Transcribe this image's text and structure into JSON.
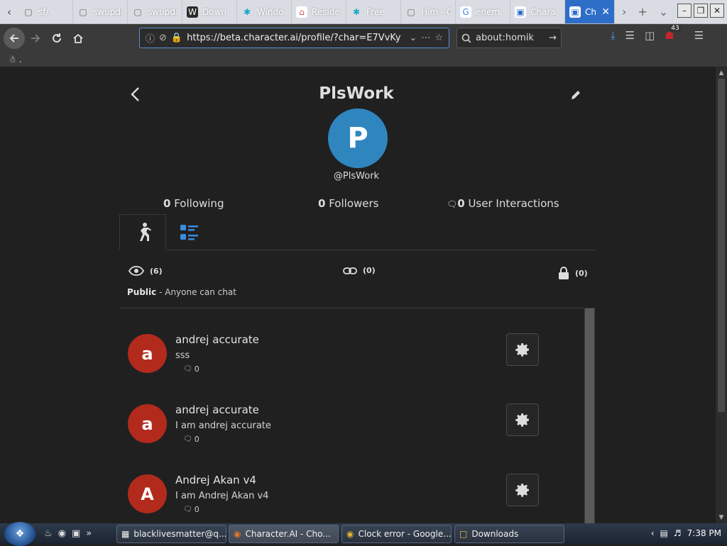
{
  "browser": {
    "tabs": [
      {
        "label": "sf/",
        "icon": "page-icon",
        "fav_bg": "#d9dde3",
        "fav_fg": "#666"
      },
      {
        "label": "swupdate",
        "icon": "page-icon",
        "fav_bg": "#d9dde3",
        "fav_fg": "#666"
      },
      {
        "label": "swupdate",
        "icon": "page-icon",
        "fav_bg": "#d9dde3",
        "fav_fg": "#666"
      },
      {
        "label": "Down",
        "icon": "w-logo-icon",
        "fav_bg": "#2a2a2a",
        "fav_fg": "#fff"
      },
      {
        "label": "Windo",
        "icon": "asterisk-icon",
        "fav_bg": "transparent",
        "fav_fg": "#1aa6c9"
      },
      {
        "label": "Reside",
        "icon": "house-icon",
        "fav_bg": "#fff",
        "fav_fg": "#d9534f"
      },
      {
        "label": "Free",
        "icon": "asterisk-icon",
        "fav_bg": "transparent",
        "fav_fg": "#1aa6c9"
      },
      {
        "label": "Him - Cha",
        "icon": "page-icon",
        "fav_bg": "#d9dde3",
        "fav_fg": "#666"
      },
      {
        "label": "enem",
        "icon": "google-icon",
        "fav_bg": "#fff",
        "fav_fg": "#4285f4"
      },
      {
        "label": "Chara",
        "icon": "character-ai-icon",
        "fav_bg": "#fff",
        "fav_fg": "#2e6ec8"
      },
      {
        "label": "Ch",
        "icon": "character-ai-icon",
        "fav_bg": "#fff",
        "fav_fg": "#2e6ec8"
      }
    ],
    "url": "https://beta.character.ai/profile/?char=E7VvKy",
    "search_value": "about:homik",
    "addon_badge": "43",
    "bookmark_label": "."
  },
  "page": {
    "title": "PlsWork",
    "avatar_letter": "P",
    "handle": "@PlsWork",
    "stats": [
      {
        "count": "0",
        "label": "Following"
      },
      {
        "count": "0",
        "label": "Followers"
      },
      {
        "count": "0",
        "label": "User Interactions"
      }
    ],
    "filters": [
      {
        "icon": "eye-icon",
        "count": "(6)"
      },
      {
        "icon": "link-icon",
        "count": "(0)"
      },
      {
        "icon": "lock-icon",
        "count": "(0)"
      }
    ],
    "visibility": {
      "label": "Public",
      "description": " - Anyone can chat"
    },
    "characters": [
      {
        "letter": "a",
        "name": "andrej accurate",
        "description": "sss",
        "interactions": "0"
      },
      {
        "letter": "a",
        "name": "andrej accurate",
        "description": "I am andrej accurate",
        "interactions": "0"
      },
      {
        "letter": "A",
        "name": "Andrej Akan v4",
        "description": "I am Andrej Akan v4",
        "interactions": "0"
      }
    ]
  },
  "taskbar": {
    "tasks": [
      {
        "label": "blacklivesmatter@q...",
        "icon": "window-icon"
      },
      {
        "label": "Character.AI - Cho...",
        "icon": "firefox-icon"
      },
      {
        "label": "Clock error - Google...",
        "icon": "chrome-icon"
      },
      {
        "label": "Downloads",
        "icon": "folder-icon"
      }
    ],
    "time": "7:38 PM"
  },
  "colors": {
    "accent": "#2f86bf",
    "avatar_red": "#b22a1c",
    "background": "#202020"
  }
}
